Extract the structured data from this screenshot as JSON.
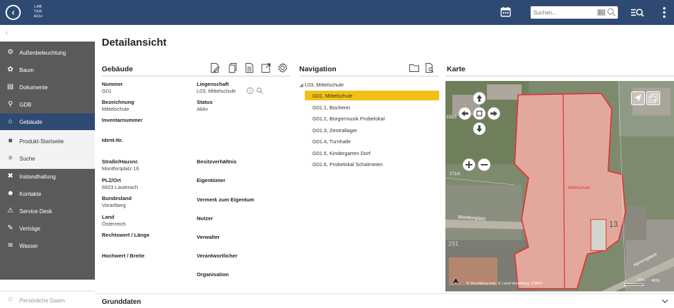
{
  "header": {
    "logo_text_1": "LAB",
    "logo_text_2": "TER",
    "logo_text_3": "ACH",
    "search_placeholder": "Suchen..."
  },
  "sidebar": {
    "items": [
      {
        "label": "Außenbeleuchtung",
        "icon": "lamp-icon"
      },
      {
        "label": "Baum",
        "icon": "tree-icon"
      },
      {
        "label": "Dokumente",
        "icon": "document-icon"
      },
      {
        "label": "GDB",
        "icon": "database-icon"
      },
      {
        "label": "Gebäude",
        "icon": "building-icon",
        "active": true
      },
      {
        "label": "Produkt-Startseite",
        "icon": "product-home-icon"
      },
      {
        "label": "Suche",
        "icon": "filter-search-icon"
      },
      {
        "label": "Instandhaltung",
        "icon": "wrench-icon"
      },
      {
        "label": "Kontakte",
        "icon": "contacts-icon"
      },
      {
        "label": "Service Desk",
        "icon": "warning-icon"
      },
      {
        "label": "Verträge",
        "icon": "contract-icon"
      },
      {
        "label": "Wasser",
        "icon": "water-icon"
      }
    ],
    "personal_data": "Persönliche Daten"
  },
  "page": {
    "title": "Detailansicht"
  },
  "gebaeude": {
    "header": "Gebäude",
    "fields_left": [
      {
        "label": "Nummer",
        "value": "G01"
      },
      {
        "label": "Bezeichnung",
        "value": "Mittelschule"
      },
      {
        "label": "Inventarnummer",
        "value": ""
      },
      {
        "label": "Ident-Nr.",
        "value": ""
      },
      {
        "label": "Straße/Hausnr.",
        "value": "Montfortplatz 16"
      },
      {
        "label": "PLZ/Ort",
        "value": "6923 Lauterach"
      },
      {
        "label": "Bundesland",
        "value": "Vorarlberg"
      },
      {
        "label": "Land",
        "value": "Österreich"
      },
      {
        "label": "Rechtswert / Länge",
        "value": ""
      },
      {
        "label": "Hochwert / Breite",
        "value": ""
      }
    ],
    "fields_right": [
      {
        "label": "Liegenschaft",
        "value": "L03, Mittelschule"
      },
      {
        "label": "Status",
        "value": "Aktiv"
      },
      {
        "label": "Besitzverhältnis",
        "value": ""
      },
      {
        "label": "Eigentümer",
        "value": ""
      },
      {
        "label": "Vermerk zum Eigentum",
        "value": ""
      },
      {
        "label": "Nutzer",
        "value": ""
      },
      {
        "label": "Verwalter",
        "value": ""
      },
      {
        "label": "Verantwortlicher",
        "value": ""
      },
      {
        "label": "Organisation",
        "value": ""
      }
    ]
  },
  "navigation": {
    "header": "Navigation",
    "root": "L03, Mittelschule",
    "items": [
      {
        "label": "G01, Mittelschule",
        "selected": true
      },
      {
        "label": "G01.1, Bücherei"
      },
      {
        "label": "G01.2, Bürgermusik Probelokal"
      },
      {
        "label": "G01.3, Zentrallager"
      },
      {
        "label": "G01.4, Turnhalle"
      },
      {
        "label": "G01.5, Kindergarten Dorf"
      },
      {
        "label": "G01.6, Probelokal Schalmeien"
      }
    ]
  },
  "karte": {
    "header": "Karte",
    "street_label": "Montfortplatz",
    "street_label_2": "Herrengasse",
    "building_label": "Mittelschule",
    "parcel_1": "153/3",
    "parcel_2": "271/3",
    "parcel_3": "291",
    "parcel_4": "13",
    "attribution": "© Vorarlberg.netz, © Land Vorarlberg, © BEV",
    "scale": "10m",
    "scale_2": "4699"
  },
  "bottom": {
    "title": "Grunddaten"
  },
  "colors": {
    "header_bg": "#2e4a73",
    "sidebar_dark": "#5a5a5a",
    "selected_tree": "#f2c013",
    "building_outline": "#e0312e"
  }
}
